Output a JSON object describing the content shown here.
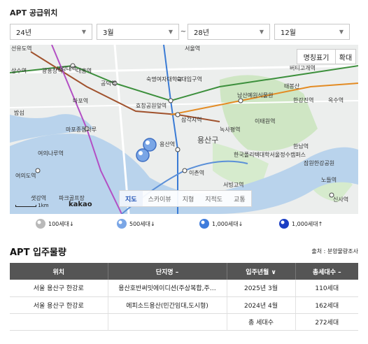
{
  "supply": {
    "title": "APT 공급위치",
    "start_year": "24년",
    "start_month": "3월",
    "separator": "~",
    "end_year": "28년",
    "end_month": "12월"
  },
  "map": {
    "btn_labels": "명칭표기",
    "btn_zoom": "확대",
    "tabs": [
      "지도",
      "스카이뷰",
      "지형",
      "지적도",
      "교통"
    ],
    "active_tab": "지도",
    "scale": "1km",
    "brand": "kakao",
    "district": "용산구",
    "places": {
      "p1": "서강대역",
      "p2": "상수역",
      "p3": "광흥창역",
      "p4": "대흥역",
      "p5": "공덕역",
      "p6": "숙명여자대학교",
      "p7": "숙대입구역",
      "p8": "마포역",
      "p9": "효창공원앞역",
      "p10": "남산예원식물원",
      "p11": "태봉산",
      "p12": "한강진역",
      "p13": "삼각지역",
      "p14": "녹사평역",
      "p15": "이태원역",
      "p16": "마포종점나루",
      "p17": "여의나루역",
      "p18": "여의도역",
      "p19": "샛강역",
      "p20": "파크골프장",
      "p21": "용산역",
      "p22": "이촌역",
      "p23": "한국폴리텍대학서울정수캠퍼스",
      "p24": "한남역",
      "p25": "잠원한강공원",
      "p26": "서빙고역",
      "p27": "옥수역",
      "p28": "버티고개역",
      "p29": "서울역",
      "p30": "신사역",
      "p31": "노들역",
      "p32": "선유도역",
      "p33": "밤섬"
    }
  },
  "legend": [
    {
      "label": "100세대↓",
      "color": "#b9b9b9"
    },
    {
      "label": "500세대↓",
      "color": "#7aa6e6"
    },
    {
      "label": "1,000세대↓",
      "color": "#3f7cdc"
    },
    {
      "label": "1,000세대↑",
      "color": "#1c3fc4"
    }
  ],
  "occupancy": {
    "title": "APT 입주물량",
    "source": "출처 : 분양물량조사",
    "headers": [
      "위치",
      "단지명 –",
      "입주년월 ∨",
      "총세대수 –"
    ],
    "rows": [
      [
        "서울 용산구 한강로",
        "용산호반써밋에이디션(주상복합,주…",
        "2025년 3월",
        "110세대"
      ],
      [
        "서울 용산구 한강로",
        "에피소드용산(민간임대,도시형)",
        "2024년 4월",
        "162세대"
      ]
    ],
    "total_label": "총 세대수",
    "total_value": "272세대"
  }
}
